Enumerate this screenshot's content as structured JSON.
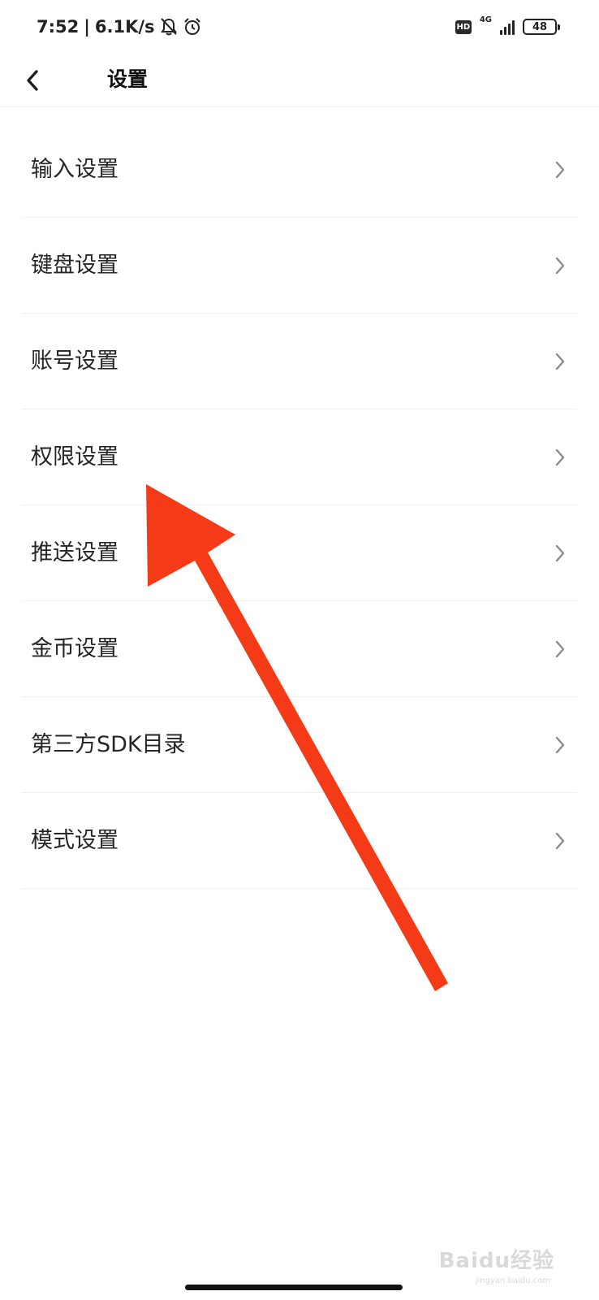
{
  "status_bar": {
    "time": "7:52",
    "separator": "|",
    "net_speed": "6.1K/s",
    "hd_label": "HD",
    "network_type": "4G",
    "battery_level": "48",
    "icons": [
      "bell-off-icon",
      "alarm-clock-icon",
      "hd-icon",
      "signal-icon",
      "battery-icon"
    ]
  },
  "header": {
    "back_icon": "chevron-left-icon",
    "title": "设置"
  },
  "settings": {
    "items": [
      {
        "label": "输入设置"
      },
      {
        "label": "键盘设置"
      },
      {
        "label": "账号设置"
      },
      {
        "label": "权限设置"
      },
      {
        "label": "推送设置"
      },
      {
        "label": "金币设置"
      },
      {
        "label": "第三方SDK目录"
      },
      {
        "label": "模式设置"
      }
    ],
    "item_icon": "chevron-right-icon"
  },
  "annotation": {
    "color": "#f43a17",
    "icon": "red-arrow"
  },
  "watermark": {
    "text": "Baidu经验",
    "sub": "jingyan.baidu.com"
  }
}
